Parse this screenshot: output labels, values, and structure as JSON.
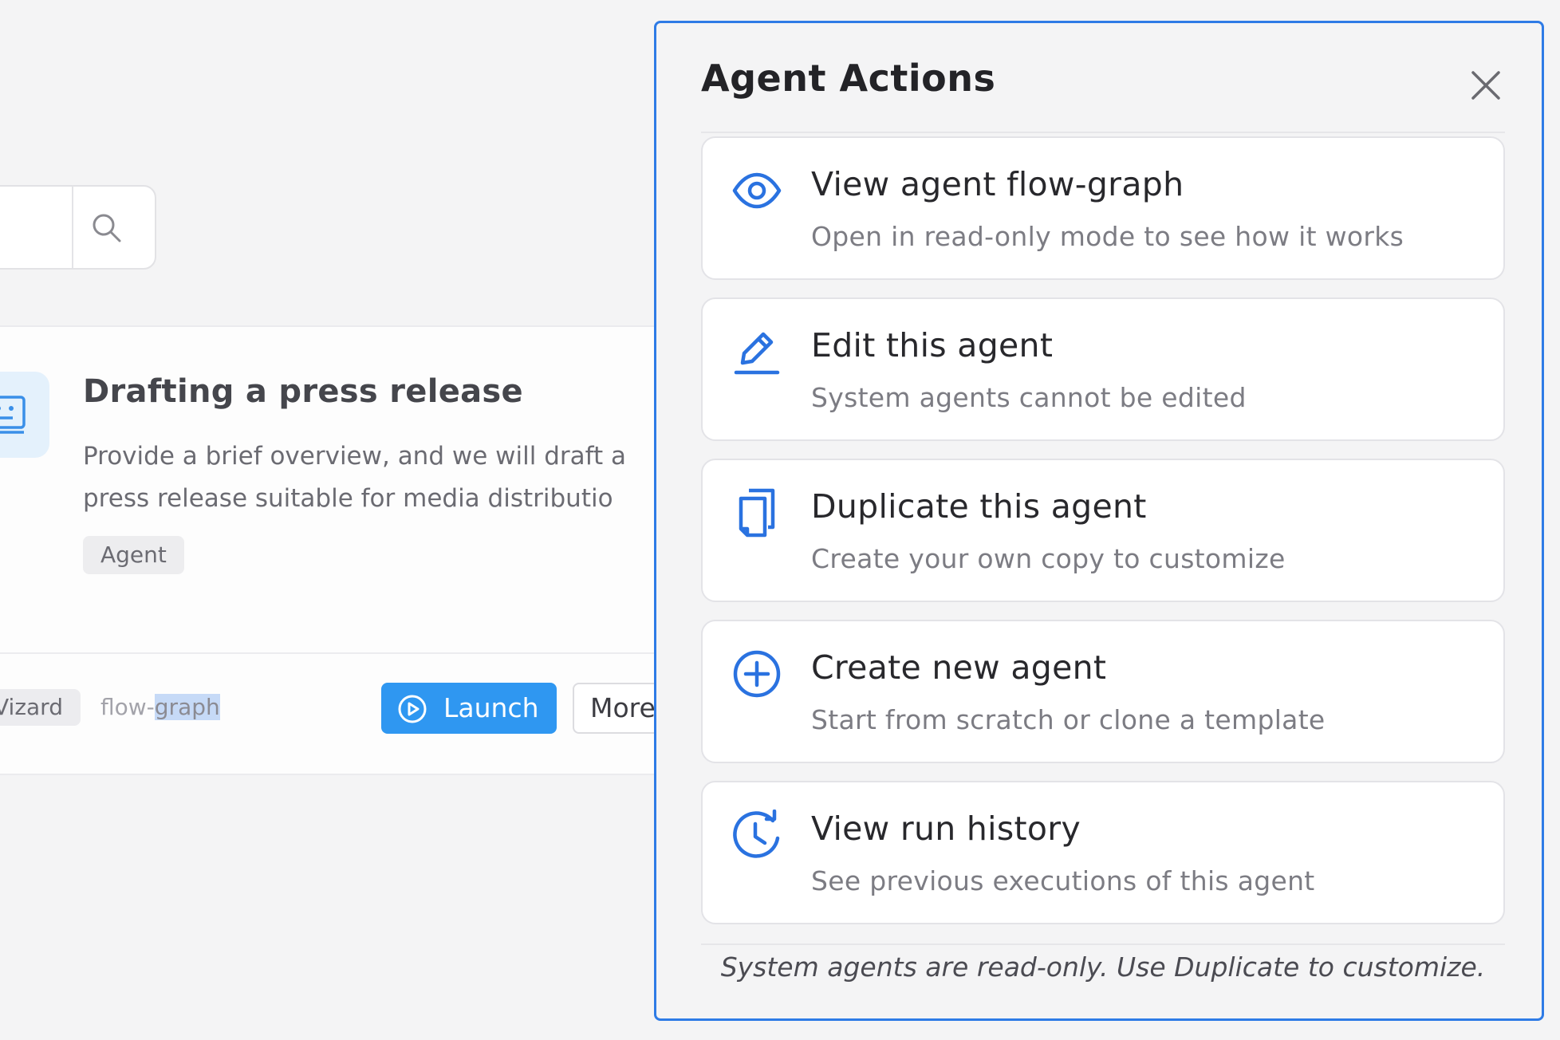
{
  "background": {
    "card": {
      "title": "Drafting a press release",
      "description_line1": "Provide a brief overview, and we will draft a",
      "description_line2": "press release suitable for media distributio",
      "tag": "Agent"
    },
    "footer": {
      "tag_partial": "Vizard",
      "flow_graph_prefix": "flow-",
      "flow_graph_selected": "graph",
      "launch_label": "Launch",
      "more_label": "More"
    }
  },
  "panel": {
    "title": "Agent Actions",
    "actions": [
      {
        "icon": "eye-icon",
        "title": "View agent flow-graph",
        "subtitle": "Open in read-only mode to see how it works"
      },
      {
        "icon": "pencil-icon",
        "title": "Edit this agent",
        "subtitle": "System agents cannot be edited"
      },
      {
        "icon": "duplicate-icon",
        "title": "Duplicate this agent",
        "subtitle": "Create your own copy to customize"
      },
      {
        "icon": "plus-circle-icon",
        "title": "Create new agent",
        "subtitle": "Start from scratch or clone a template"
      },
      {
        "icon": "history-icon",
        "title": "View run history",
        "subtitle": "See previous executions of this agent"
      }
    ],
    "footer_note": "System agents are read-only. Use Duplicate to customize."
  },
  "colors": {
    "accent": "#2e7be6",
    "launch": "#2f97f1",
    "icon": "#2a72e0"
  }
}
